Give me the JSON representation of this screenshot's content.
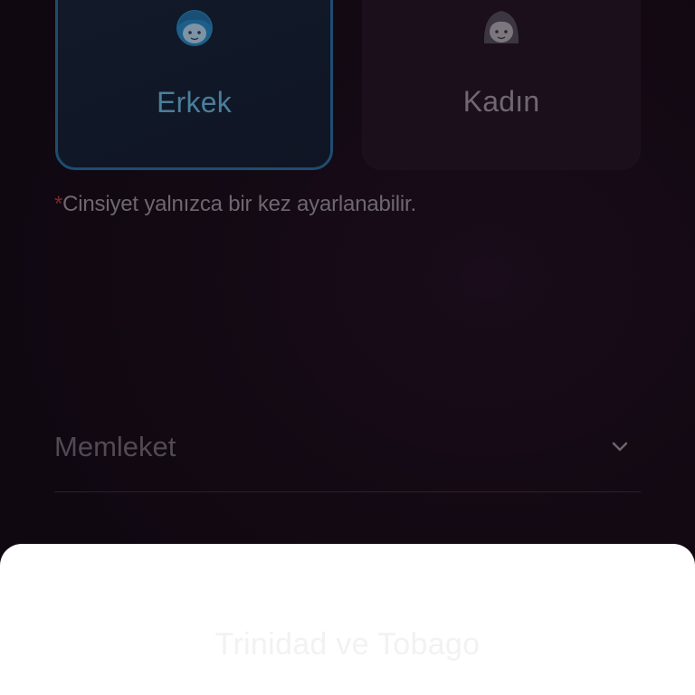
{
  "gender": {
    "male": {
      "label": "Erkek",
      "icon": "boy-face-icon",
      "selected": true,
      "color": "#1e4d70"
    },
    "female": {
      "label": "Kadın",
      "icon": "girl-face-icon",
      "selected": false
    },
    "note_asterisk": "*",
    "note_text": "Cinsiyet yalnızca bir kez ayarlanabilir."
  },
  "country": {
    "label": "Memleket",
    "icon": "chevron-down-icon"
  },
  "picker": {
    "options": [
      "Trinidad ve Tobago"
    ]
  }
}
